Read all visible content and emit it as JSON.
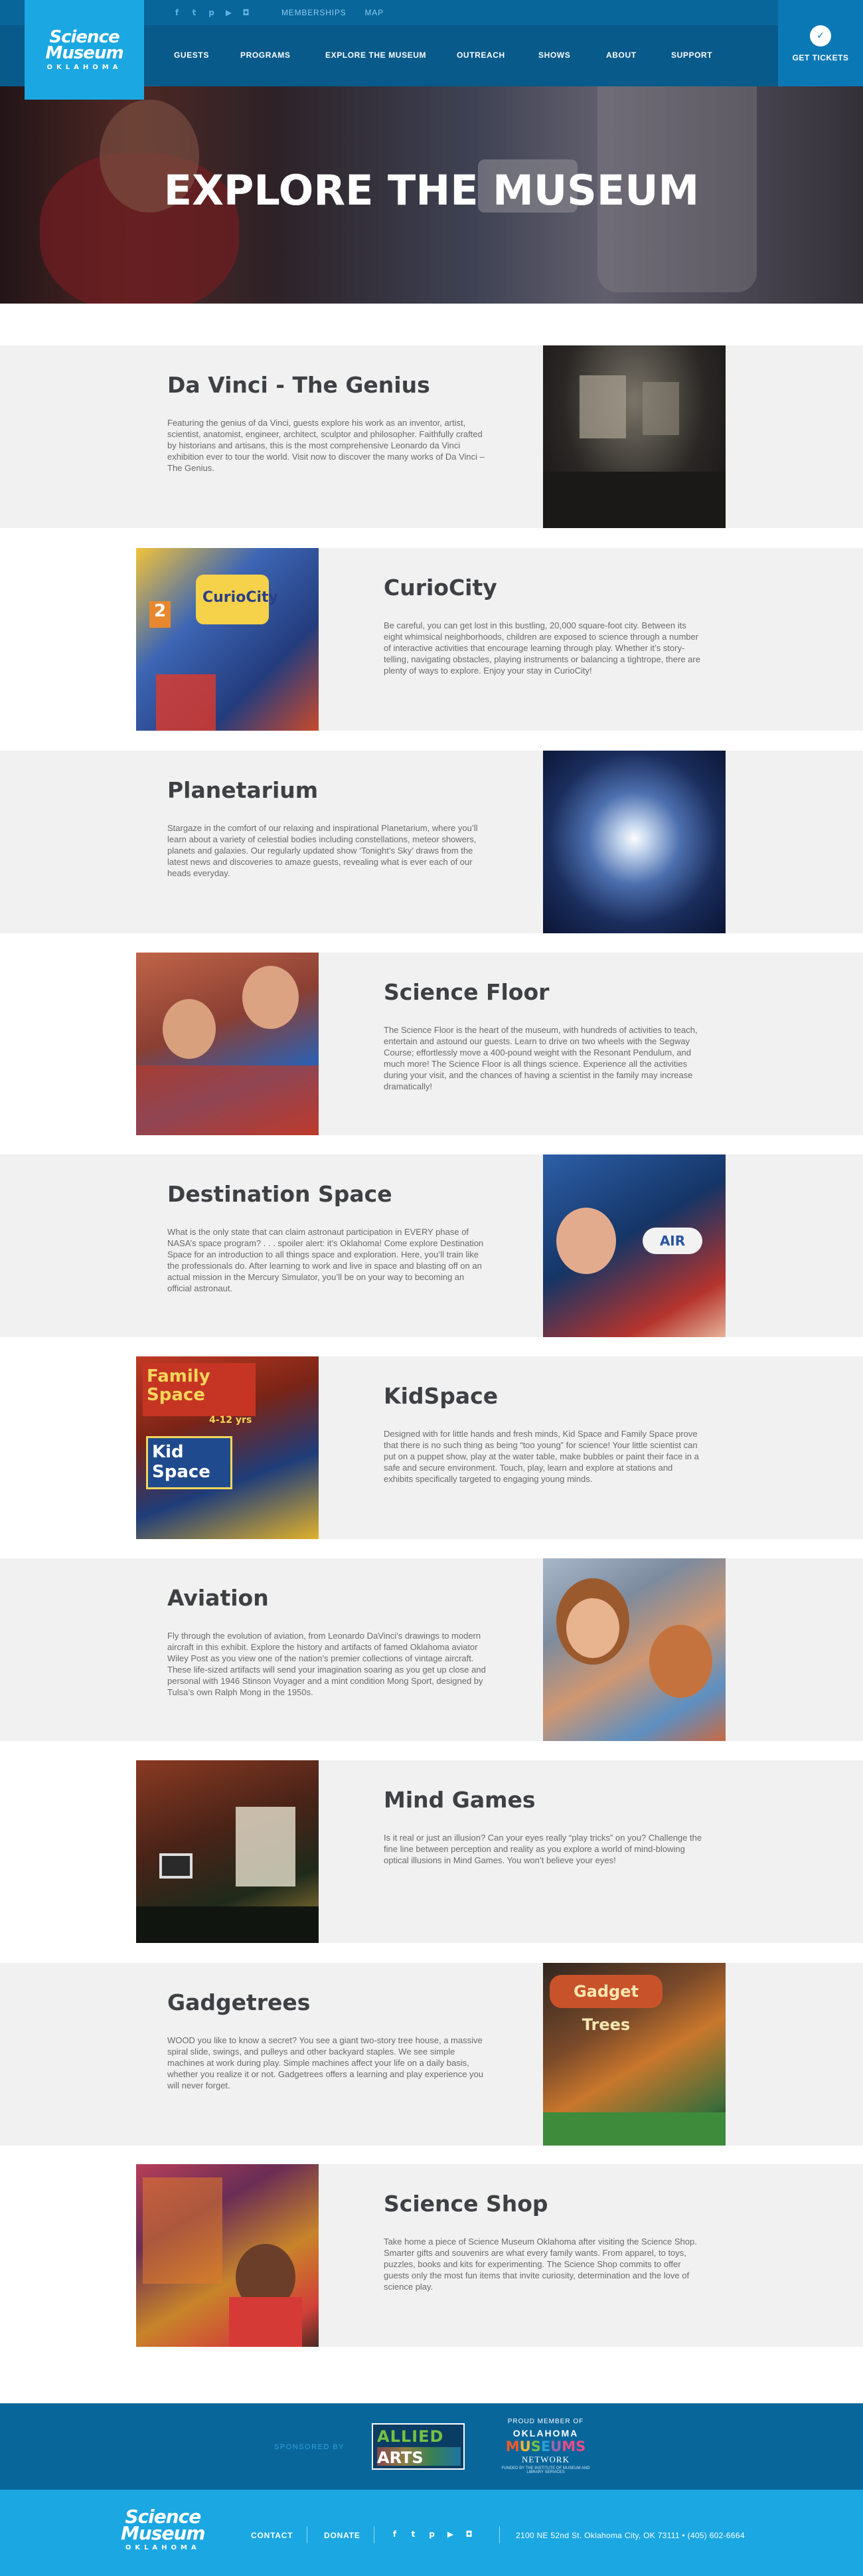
{
  "topbar": {
    "socials": [
      "facebook-icon",
      "twitter-icon",
      "pinterest-icon",
      "youtube-icon",
      "instagram-icon"
    ],
    "links": [
      "MEMBERSHIPS",
      "MAP"
    ]
  },
  "logo": {
    "line1": "Science",
    "line2": "Museum",
    "line3": "OKLAHOMA"
  },
  "nav": [
    "GUESTS",
    "PROGRAMS",
    "EXPLORE THE MUSEUM",
    "OUTREACH",
    "SHOWS",
    "ABOUT",
    "SUPPORT"
  ],
  "tickets": {
    "label": "GET TICKETS",
    "icon": "ticket-icon"
  },
  "hero": {
    "title": "EXPLORE THE MUSEUM"
  },
  "sections": [
    {
      "title": "Da Vinci - The Genius",
      "body": "Featuring the genius of da Vinci, guests explore his work as an inventor, artist, scientist, anatomist, engineer, architect, sculptor and philosopher. Faithfully crafted by historians and artisans, this is the most comprehensive Leonardo da Vinci exhibition ever to tour the world. Visit now to discover the many works of Da Vinci – The Genius."
    },
    {
      "title": "CurioCity",
      "body": "Be careful, you can get lost in this bustling, 20,000 square-foot city. Between its eight whimsical neighborhoods, children are exposed to science through a number of interactive activities that encourage learning through play. Whether it’s story-telling, navigating obstacles, playing instruments or balancing a tightrope, there are plenty of ways to explore. Enjoy your stay in CurioCity!"
    },
    {
      "title": "Planetarium",
      "body": "Stargaze in the comfort of our relaxing and inspirational Planetarium, where you’ll learn about a variety of celestial bodies including constellations, meteor showers, planets and galaxies. Our regularly updated show ‘Tonight’s Sky’ draws from the latest news and discoveries to amaze guests, revealing what is ever each of our heads everyday."
    },
    {
      "title": "Science Floor",
      "body": "The Science Floor is the heart of the museum, with hundreds of activities to teach, entertain and astound our guests. Learn to drive on two wheels with the Segway Course; effortlessly move a 400-pound weight with the Resonant Pendulum, and much more! The Science Floor is all things science. Experience all the activities during your visit, and the chances of having a scientist in the family may increase dramatically!"
    },
    {
      "title": "Destination Space",
      "body": "What is the only state that can claim astronaut participation in EVERY phase of NASA’s space program? . . . spoiler alert: it’s Oklahoma! Come explore Destination Space for an introduction to all things space and exploration. Here, you’ll train like the professionals do. After learning to work and live in space and blasting off on an actual mission in the Mercury Simulator, you’ll be on your way to becoming an official astronaut."
    },
    {
      "title": "KidSpace",
      "body": "Designed with for little hands and fresh minds, Kid Space and Family Space prove that there is no such thing as being “too young” for science! Your little scientist can put on a puppet show, play at the water table, make bubbles or paint their face in a safe and secure environment. Touch, play, learn and explore at stations and exhibits specifically targeted to engaging young minds."
    },
    {
      "title": "Aviation",
      "body": "Fly through the evolution of aviation, from Leonardo DaVinci’s drawings to modern aircraft in this exhibit. Explore the history and artifacts of famed Oklahoma aviator Wiley Post as you view one of the nation’s premier collections of vintage aircraft. These life-sized artifacts will send your imagination soaring as you get up close and personal with 1946 Stinson Voyager and a mint condition Mong Sport, designed by Tulsa’s own Ralph Mong in the 1950s."
    },
    {
      "title": "Mind Games",
      "body": "Is it real or just an illusion? Can your eyes really “play tricks” on you? Challenge the fine line between perception and reality as you explore a world of mind-blowing optical illusions in Mind Games. You won’t believe your eyes!"
    },
    {
      "title": "Gadgetrees",
      "body": "WOOD you like to know a secret? You see a giant two-story tree house, a massive spiral slide, swings, and pulleys and other backyard staples. We see simple machines at work during play. Simple machines affect your life on a daily basis, whether you realize it or not. Gadgetrees offers a learning and play experience you will never forget."
    },
    {
      "title": "Science Shop",
      "body": "Take home a piece of Science Museum Oklahoma after visiting the Science Shop. Smarter gifts and souvenirs are what every family wants. From apparel, to toys, puzzles, books and kits for experimenting. The Science Shop commits to offer guests only the most fun items that invite curiosity, determination and the love of science play."
    }
  ],
  "photo_signs": {
    "curio": "CurioCity",
    "curio_num": "2",
    "family": "Family Space",
    "ages": "4-12 yrs",
    "kid": "Kid Space",
    "gadget": "Gadget Trees",
    "air": "AIR"
  },
  "sponsors": {
    "sponsored_by": "SPONSORED BY",
    "allied_line1": "ALLIED",
    "allied_line2": "ARTS",
    "proud_member": "PROUD MEMBER OF",
    "network_state": "OKLAHOMA",
    "network_museums": [
      "M",
      "U",
      "S",
      "E",
      "U",
      "MS"
    ],
    "network_word": "NETWORK",
    "network_tag": "FUNDED BY THE INSTITUTE OF MUSEUM AND LIBRARY SERVICES"
  },
  "footer": {
    "logo_line1": "Science",
    "logo_line2": "Museum",
    "logo_line3": "OKLAHOMA",
    "contact": "CONTACT",
    "donate": "DONATE",
    "socials": [
      "facebook-icon",
      "twitter-icon",
      "pinterest-icon",
      "youtube-icon",
      "instagram-icon"
    ],
    "address": "2100 NE 52nd St. Oklahoma City, OK 73111 • (405) 602-6664"
  },
  "colors": {
    "dark_blue": "#075a8a",
    "mid_blue": "#08669b",
    "bright_blue": "#1ba7e1",
    "section_bg": "#f1f1f1"
  }
}
